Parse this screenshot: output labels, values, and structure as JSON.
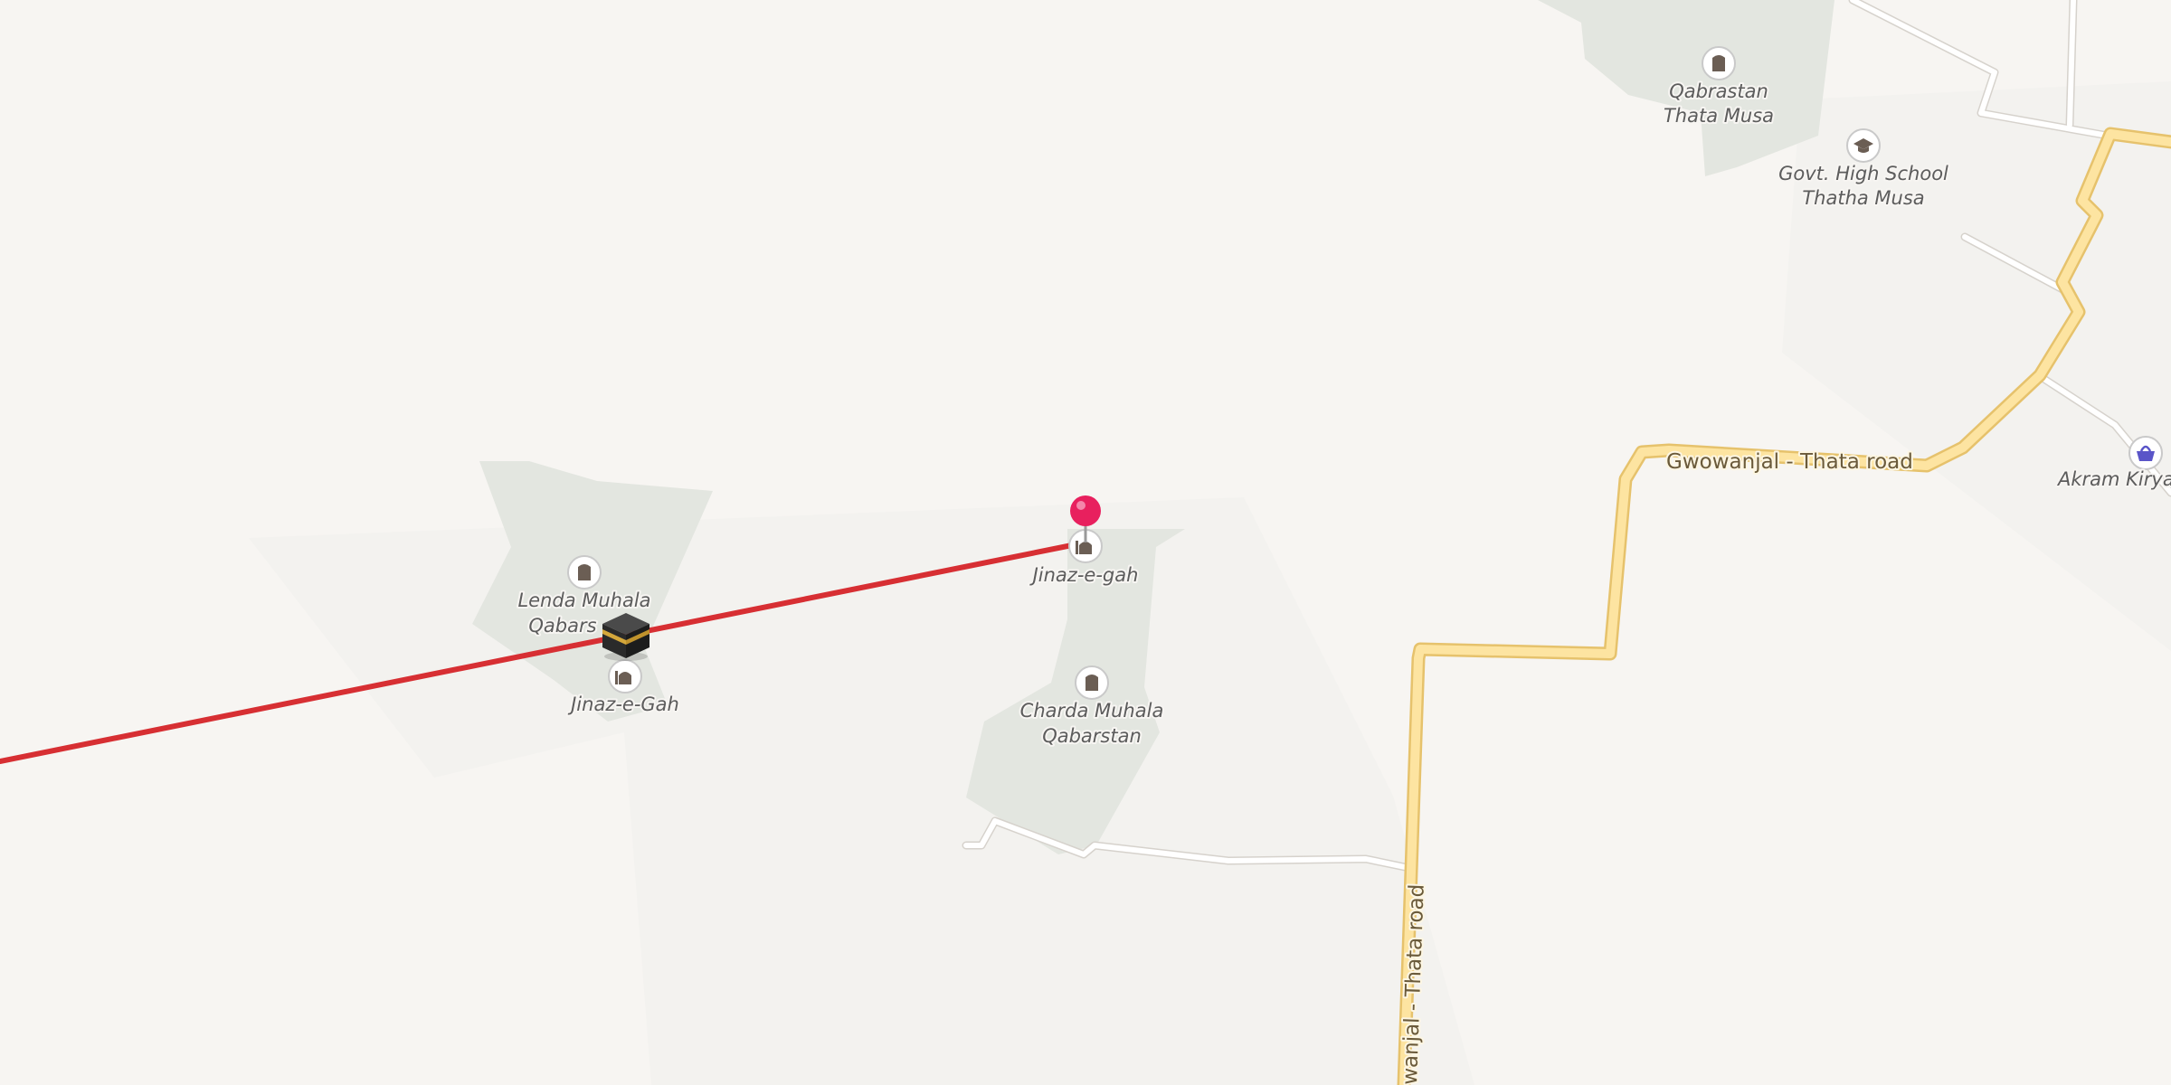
{
  "map": {
    "colors": {
      "background": "#f7f5f2",
      "landuse": "#e3e6e0",
      "main_road_fill": "#fde4a1",
      "main_road_casing": "#e6c26c",
      "minor_road": "#ffffff",
      "route_line": "#d72f33",
      "pin": "#e8205e"
    },
    "pois": [
      {
        "id": "qabrastan-thata-musa",
        "label_lines": [
          "Qabrastan",
          "Thata Musa"
        ],
        "icon": "cemetery-icon"
      },
      {
        "id": "govt-high-school",
        "label_lines": [
          "Govt. High School",
          "Thatha Musa"
        ],
        "icon": "school-icon"
      },
      {
        "id": "akram-kiryana",
        "label_lines": [
          "Akram Kirya"
        ],
        "icon": "shop-basket-icon"
      },
      {
        "id": "jinaz-e-gah-center",
        "label_lines": [
          "Jinaz-e-gah"
        ],
        "icon": "mosque-icon"
      },
      {
        "id": "charda-muhala-qabarstan",
        "label_lines": [
          "Charda Muhala",
          "Qabarstan"
        ],
        "icon": "cemetery-icon"
      },
      {
        "id": "lenda-muhala-qabarstan",
        "label_lines": [
          "Lenda Muhala",
          "Qabars"
        ],
        "icon": "cemetery-icon"
      },
      {
        "id": "jinaz-e-gah-left",
        "label_lines": [
          "Jinaz-e-Gah"
        ],
        "icon": "mosque-icon"
      }
    ],
    "road_labels": {
      "gwowanjal_thata_horizontal": "Gwowanjal - Thata road",
      "gwowanjal_thata_vertical": "wanjal - Thata road"
    },
    "markers": {
      "qibla_icon": "kaaba-icon",
      "pin_icon": "location-pin-icon"
    }
  }
}
